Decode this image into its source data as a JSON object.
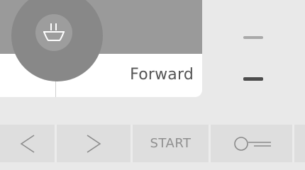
{
  "status": {
    "direction_label": "Forward"
  },
  "toolbar": {
    "prev_icon": "chevron-left-icon",
    "next_icon": "chevron-right-icon",
    "start_label": "START",
    "key_icon": "key-icon"
  },
  "knob": {
    "icon": "wash-basin-pause-icon"
  },
  "colors": {
    "background": "#e9e9e9",
    "panel_top": "#9a9a9a",
    "knob": "#888888",
    "button": "#dedede",
    "level_inactive": "#a9a9a9",
    "level_active": "#4c4c4c"
  }
}
